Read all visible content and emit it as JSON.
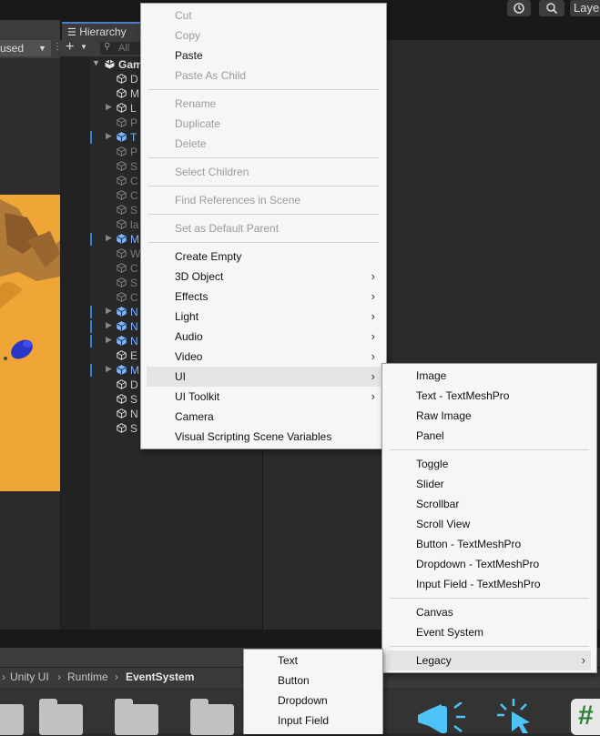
{
  "toolbar": {
    "layers_label": "Laye"
  },
  "game": {
    "dropdown_label": "used"
  },
  "hierarchy": {
    "tab_label": "Hierarchy",
    "search_placeholder": "All",
    "root_label": "Gam",
    "rows": [
      {
        "label": "D",
        "style": "normal"
      },
      {
        "label": "M",
        "style": "normal"
      },
      {
        "label": "L",
        "style": "normal"
      },
      {
        "label": "P",
        "style": "dim"
      },
      {
        "label": "T",
        "style": "blue"
      },
      {
        "label": "P",
        "style": "dim"
      },
      {
        "label": "S",
        "style": "dim"
      },
      {
        "label": "C",
        "style": "dim"
      },
      {
        "label": "C",
        "style": "dim"
      },
      {
        "label": "S",
        "style": "dim"
      },
      {
        "label": "la",
        "style": "dim"
      },
      {
        "label": "M",
        "style": "blue"
      },
      {
        "label": "W",
        "style": "dim"
      },
      {
        "label": "C",
        "style": "dim"
      },
      {
        "label": "S",
        "style": "dim"
      },
      {
        "label": "C",
        "style": "dim"
      },
      {
        "label": "N",
        "style": "blue"
      },
      {
        "label": "N",
        "style": "blue"
      },
      {
        "label": "N",
        "style": "blue"
      },
      {
        "label": "E",
        "style": "normal"
      },
      {
        "label": "M",
        "style": "blue"
      },
      {
        "label": "D",
        "style": "normal"
      },
      {
        "label": "S",
        "style": "normal"
      },
      {
        "label": "N",
        "style": "normal"
      },
      {
        "label": "S",
        "style": "normal"
      }
    ]
  },
  "breadcrumb": {
    "items": [
      "Unity UI",
      "Runtime",
      "EventSystem"
    ]
  },
  "context_menu": {
    "cut": "Cut",
    "copy": "Copy",
    "paste": "Paste",
    "paste_as_child": "Paste As Child",
    "rename": "Rename",
    "duplicate": "Duplicate",
    "delete": "Delete",
    "select_children": "Select Children",
    "find_references": "Find References in Scene",
    "set_default_parent": "Set as Default Parent",
    "create_empty": "Create Empty",
    "object_3d": "3D Object",
    "effects": "Effects",
    "light": "Light",
    "audio": "Audio",
    "video": "Video",
    "ui": "UI",
    "ui_toolkit": "UI Toolkit",
    "camera": "Camera",
    "visual_scripting": "Visual Scripting Scene Variables"
  },
  "ui_submenu": {
    "image": "Image",
    "text_tmp": "Text - TextMeshPro",
    "raw_image": "Raw Image",
    "panel": "Panel",
    "toggle": "Toggle",
    "slider": "Slider",
    "scrollbar": "Scrollbar",
    "scroll_view": "Scroll View",
    "button_tmp": "Button - TextMeshPro",
    "dropdown_tmp": "Dropdown - TextMeshPro",
    "input_field_tmp": "Input Field - TextMeshPro",
    "canvas": "Canvas",
    "event_system": "Event System",
    "legacy": "Legacy"
  },
  "legacy_submenu": {
    "text": "Text",
    "button": "Button",
    "dropdown": "Dropdown",
    "input_field": "Input Field"
  },
  "colors": {
    "accent_blue": "#3a7ed6",
    "game_view_orange": "#f0a637",
    "menu_bg": "#f6f6f6"
  }
}
